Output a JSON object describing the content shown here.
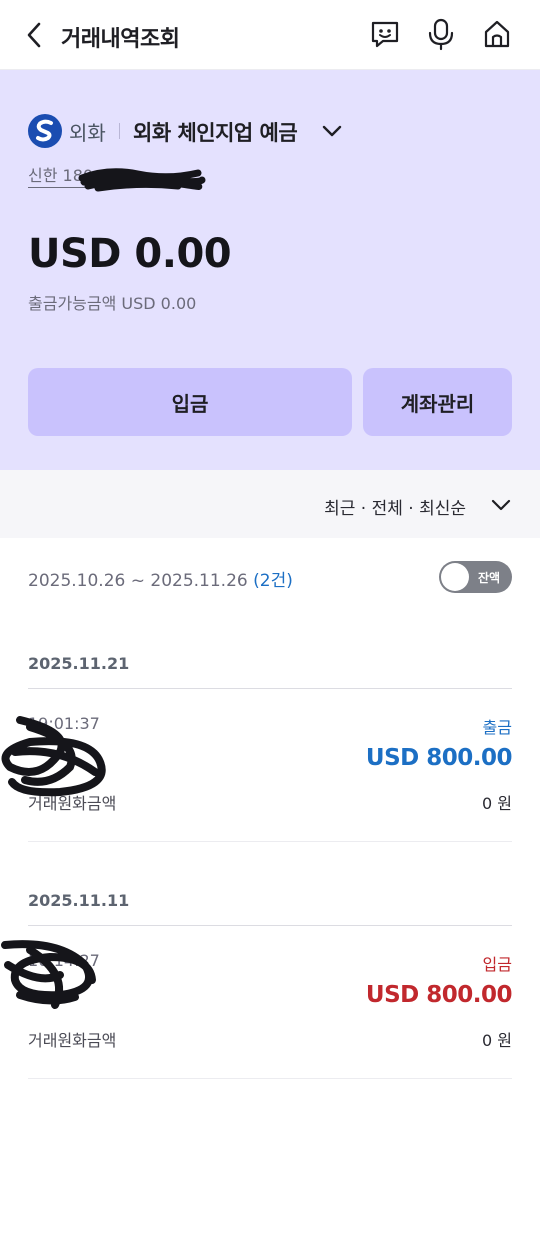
{
  "header": {
    "title": "거래내역조회",
    "icons": [
      "back-icon",
      "chat-icon",
      "mic-icon",
      "home-icon"
    ]
  },
  "account": {
    "bank_type": "외화",
    "product_name": "외화 체인지업 예금",
    "account_number": "신한 180-022-",
    "balance": "USD 0.00",
    "available": "출금가능금액 USD 0.00",
    "deposit_button": "입금",
    "manage_button": "계좌관리"
  },
  "filter": {
    "label": "최근 · 전체 · 최신순"
  },
  "range": {
    "dates": "2025.10.26 ~ 2025.11.26 ",
    "count": "(2건)",
    "toggle_label": "잔액"
  },
  "transactions": [
    {
      "date": "2025.11.21",
      "time": "19:01:37",
      "type": "출금",
      "amount": "USD 800.00",
      "krw_label": "거래원화금액",
      "krw_value": "0 원"
    },
    {
      "date": "2025.11.11",
      "time": "10:14:27",
      "type": "입금",
      "amount": "USD 800.00",
      "krw_label": "거래원화금액",
      "krw_value": "0 원"
    }
  ],
  "colors": {
    "accent_bg": "#e4e1fe",
    "button_bg": "#c9c2fd",
    "withdraw": "#1c6fc4",
    "deposit": "#c1282d"
  }
}
